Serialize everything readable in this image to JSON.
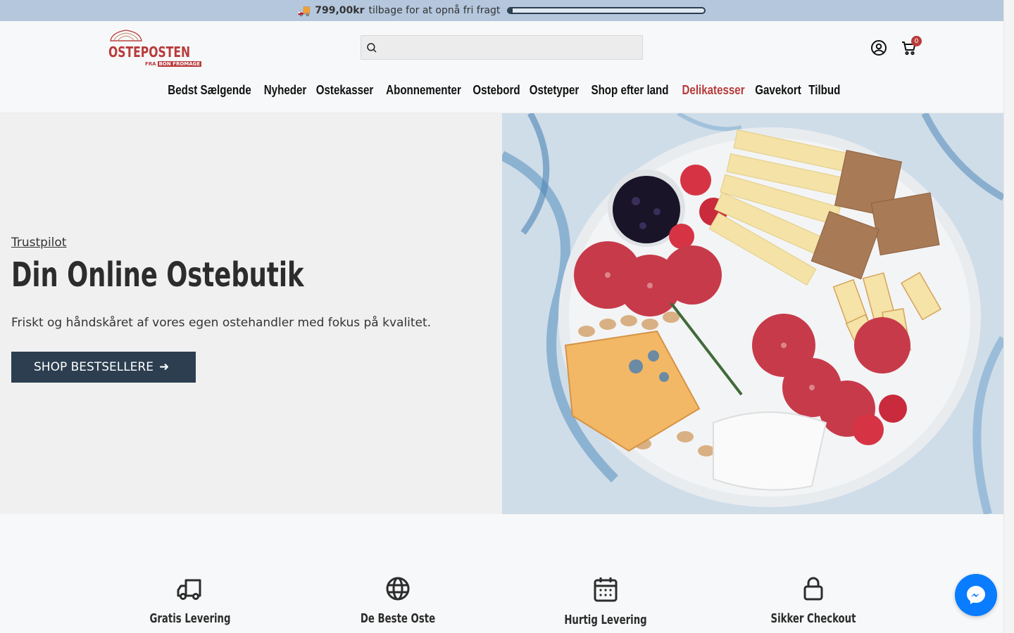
{
  "announcement": {
    "amount": "799,00kr",
    "text": "tilbage for at opnå fri fragt",
    "progress_fraction": 0.02
  },
  "header": {
    "logo_text": "OSTEPOSTEN",
    "logo_sub_prefix": "FRA",
    "logo_sub_brand": "BON FROMAGE",
    "search_placeholder": "",
    "cart_count": "0"
  },
  "nav": {
    "items": [
      {
        "label": "Bedst Sælgende"
      },
      {
        "label": "Nyheder"
      },
      {
        "label": "Ostekasser"
      },
      {
        "label": "Abonnementer"
      },
      {
        "label": "Ostebord"
      },
      {
        "label": "Ostetyper"
      },
      {
        "label": "Shop efter land"
      },
      {
        "label": "Delikatesser"
      },
      {
        "label": "Gavekort"
      },
      {
        "label": "Tilbud"
      }
    ],
    "active_index": 7
  },
  "hero": {
    "trust_link": "Trustpilot",
    "title": "Din Online Ostebutik",
    "subtitle": "Friskt og håndskåret af vores egen ostehandler med fokus på kvalitet.",
    "cta_label": "SHOP BESTSELLERE",
    "cta_arrow": "➜"
  },
  "features": [
    {
      "icon": "truck-icon",
      "label": "Gratis Levering"
    },
    {
      "icon": "globe-icon",
      "label": "De Beste Oste"
    },
    {
      "icon": "calendar-icon",
      "label": "Hurtig Levering"
    },
    {
      "icon": "lock-icon",
      "label": "Sikker Checkout"
    }
  ],
  "colors": {
    "announcement_bg": "#b4c7dd",
    "brand_red": "#b83b3b",
    "cta_bg": "#2c3e50",
    "messenger_blue": "#0a7cff"
  }
}
